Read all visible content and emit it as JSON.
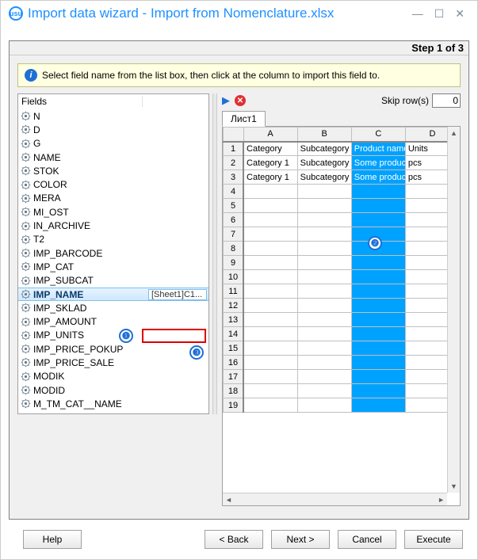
{
  "window": {
    "title": "Import data wizard - Import from Nomenclature.xlsx",
    "step": "Step 1 of 3",
    "info": "Select field name from the list box, then click at the column to import this field to."
  },
  "fields_header": "Fields",
  "fields": [
    {
      "name": "N"
    },
    {
      "name": "D"
    },
    {
      "name": "G"
    },
    {
      "name": "NAME"
    },
    {
      "name": "STOK"
    },
    {
      "name": "COLOR"
    },
    {
      "name": "MERA"
    },
    {
      "name": "MI_OST"
    },
    {
      "name": "IN_ARCHIVE"
    },
    {
      "name": "T2"
    },
    {
      "name": "IMP_BARCODE"
    },
    {
      "name": "IMP_CAT"
    },
    {
      "name": "IMP_SUBCAT"
    },
    {
      "name": "IMP_NAME",
      "selected": true,
      "mapping": "[Sheet1]C1..."
    },
    {
      "name": "IMP_SKLAD"
    },
    {
      "name": "IMP_AMOUNT"
    },
    {
      "name": "IMP_UNITS"
    },
    {
      "name": "IMP_PRICE_POKUP"
    },
    {
      "name": "IMP_PRICE_SALE"
    },
    {
      "name": "MODIK"
    },
    {
      "name": "MODID"
    },
    {
      "name": "M_TM_CAT__NAME"
    }
  ],
  "rightctrl": {
    "skip_label": "Skip row(s)",
    "skip_value": "0"
  },
  "sheet": {
    "tab": "Лист1",
    "cols": [
      "A",
      "B",
      "C",
      "D"
    ],
    "rows": [
      {
        "n": "1",
        "A": "Category",
        "B": "Subcategory",
        "C": "Product name",
        "D": "Units"
      },
      {
        "n": "2",
        "A": "Category 1",
        "B": "Subcategory",
        "C": "Some produc",
        "D": "pcs"
      },
      {
        "n": "3",
        "A": "Category 1",
        "B": "Subcategory",
        "C": "Some produc",
        "D": "pcs"
      }
    ],
    "empty_rows": [
      "4",
      "5",
      "6",
      "7",
      "8",
      "9",
      "10",
      "11",
      "12",
      "13",
      "14",
      "15",
      "16",
      "17",
      "18",
      "19"
    ]
  },
  "buttons": {
    "help": "Help",
    "back": "< Back",
    "next": "Next >",
    "cancel": "Cancel",
    "execute": "Execute"
  }
}
